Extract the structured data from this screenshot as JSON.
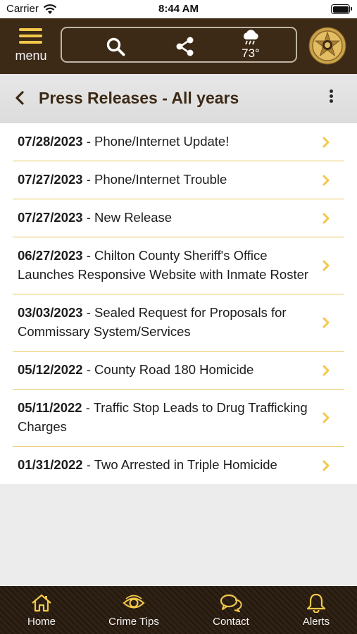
{
  "status_bar": {
    "carrier": "Carrier",
    "time": "8:44 AM"
  },
  "topbar": {
    "menu_label": "menu",
    "weather_temp": "73°",
    "icons": {
      "menu": "hamburger-menu-icon",
      "search": "search-icon",
      "share": "share-icon",
      "weather": "rain-cloud-icon",
      "badge": "sheriff-star-badge"
    }
  },
  "page": {
    "title": "Press Releases - All years"
  },
  "press_releases": [
    {
      "date": "07/28/2023",
      "title": "Phone/Internet Update!"
    },
    {
      "date": "07/27/2023",
      "title": "Phone/Internet Trouble"
    },
    {
      "date": "07/27/2023",
      "title": "New Release"
    },
    {
      "date": "06/27/2023",
      "title": "Chilton County Sheriff's Office Launches Responsive Website with Inmate Roster"
    },
    {
      "date": "03/03/2023",
      "title": "Sealed Request for Proposals for Commissary System/Services"
    },
    {
      "date": "05/12/2022",
      "title": "County Road 180 Homicide"
    },
    {
      "date": "05/11/2022",
      "title": "Traffic Stop Leads to Drug Trafficking Charges"
    },
    {
      "date": "01/31/2022",
      "title": "Two Arrested in Triple Homicide"
    }
  ],
  "tabbar": {
    "tabs": [
      {
        "label": "Home",
        "icon": "home-icon"
      },
      {
        "label": "Crime Tips",
        "icon": "eye-icon"
      },
      {
        "label": "Contact",
        "icon": "chat-bubbles-icon"
      },
      {
        "label": "Alerts",
        "icon": "bell-icon"
      }
    ]
  },
  "colors": {
    "brown": "#3c2a16",
    "gold": "#f2c84b",
    "separator": "#e9c65a"
  }
}
